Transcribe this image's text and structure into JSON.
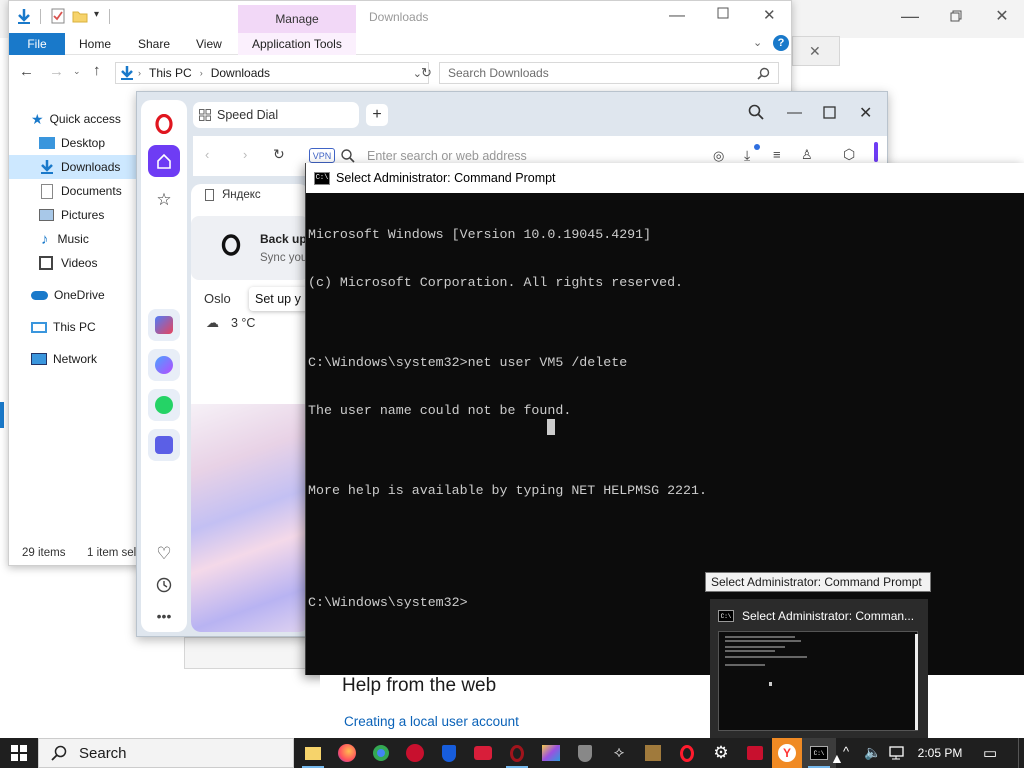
{
  "background_window": {
    "help_heading": "Help from the web",
    "help_link": "Creating a local user account"
  },
  "explorer": {
    "title": "Downloads",
    "ribbon_tabs": [
      "File",
      "Home",
      "Share",
      "View"
    ],
    "contextual_group": "Manage",
    "contextual_tab": "Application Tools",
    "breadcrumb": [
      "This PC",
      "Downloads"
    ],
    "search_placeholder": "Search Downloads",
    "nav": {
      "quick_access": "Quick access",
      "items": [
        "Desktop",
        "Downloads",
        "Documents",
        "Pictures",
        "Music",
        "Videos"
      ],
      "onedrive": "OneDrive",
      "this_pc": "This PC",
      "network": "Network"
    },
    "status": {
      "items_count": "29 items",
      "selection": "1 item sel"
    }
  },
  "opera": {
    "tab_title": "Speed Dial",
    "url_placeholder": "Enter search or web address",
    "vpn_label": "VPN",
    "bookmark": "Яндекс",
    "backup_title": "Back up",
    "backup_sub": "Sync you",
    "weather_city": "Oslo",
    "weather_temp": "3 °C",
    "setup_tooltip": "Set up y"
  },
  "cmd": {
    "title": "Select Administrator: Command Prompt",
    "lines": [
      "Microsoft Windows [Version 10.0.19045.4291]",
      "(c) Microsoft Corporation. All rights reserved.",
      "",
      "C:\\Windows\\system32>net user VM5 /delete",
      "The user name could not be found.",
      "",
      "More help is available by typing NET HELPMSG 2221.",
      "",
      "",
      "C:\\Windows\\system32>"
    ]
  },
  "tooltip": "Select Administrator: Command Prompt",
  "thumbnail_title": "Select Administrator: Comman...",
  "taskbar": {
    "search_label": "Search",
    "clock": "2:05 PM"
  }
}
